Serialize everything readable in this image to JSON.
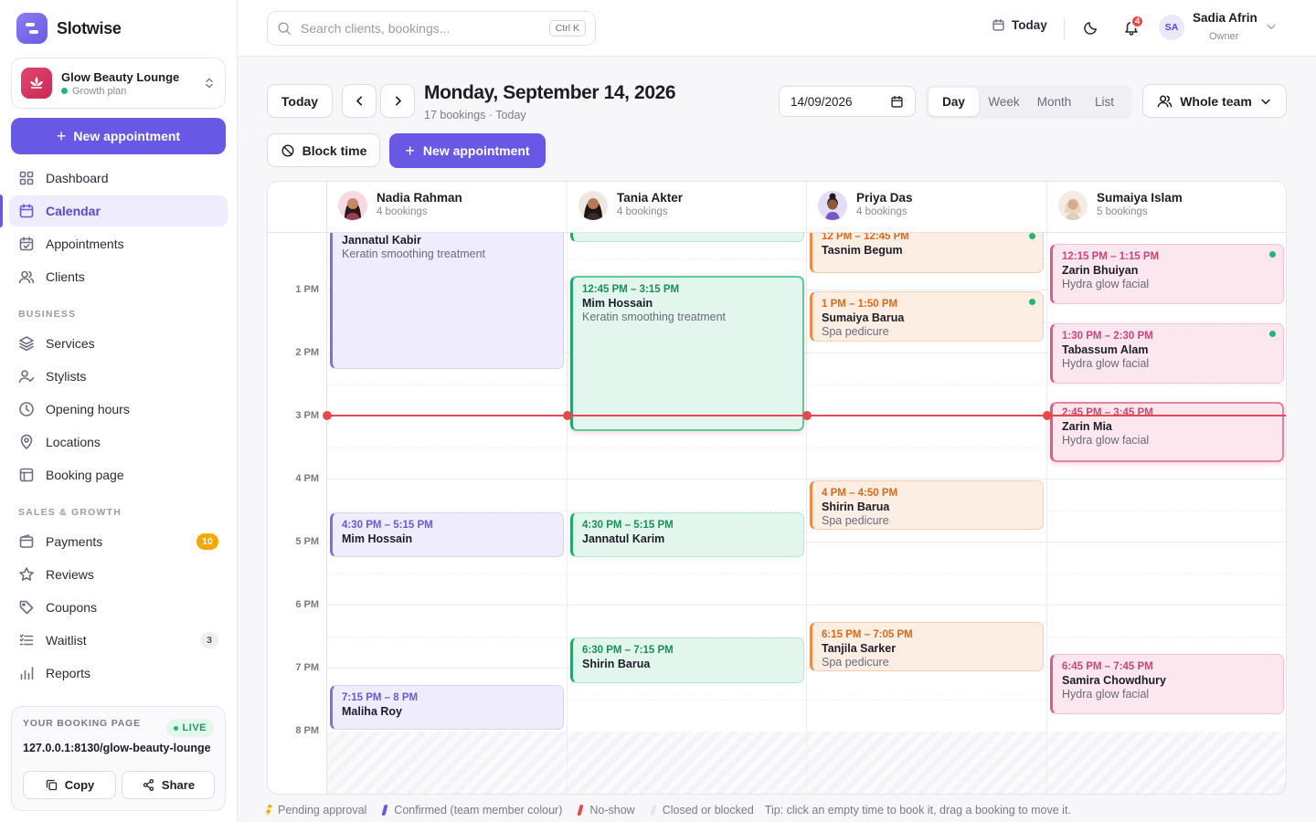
{
  "app": {
    "name": "Slotwise"
  },
  "business": {
    "name": "Glow Beauty Lounge",
    "plan": "Growth plan"
  },
  "sidebar": {
    "new_appointment": "New appointment",
    "items": [
      {
        "label": "Dashboard",
        "icon": "grid-icon"
      },
      {
        "label": "Calendar",
        "icon": "calendar-icon",
        "active": true
      },
      {
        "label": "Appointments",
        "icon": "calendar-check-icon"
      },
      {
        "label": "Clients",
        "icon": "users-icon"
      }
    ],
    "section_business": "BUSINESS",
    "business_items": [
      {
        "label": "Services",
        "icon": "layers-icon"
      },
      {
        "label": "Stylists",
        "icon": "user-check-icon"
      },
      {
        "label": "Opening hours",
        "icon": "clock-icon"
      },
      {
        "label": "Locations",
        "icon": "map-pin-icon"
      },
      {
        "label": "Booking page",
        "icon": "layout-icon"
      }
    ],
    "section_sales": "SALES & GROWTH",
    "sales_items": [
      {
        "label": "Payments",
        "icon": "wallet-icon",
        "badge": "10"
      },
      {
        "label": "Reviews",
        "icon": "star-icon"
      },
      {
        "label": "Coupons",
        "icon": "tag-icon"
      },
      {
        "label": "Waitlist",
        "icon": "list-icon",
        "badge": "3"
      },
      {
        "label": "Reports",
        "icon": "bar-chart-icon"
      }
    ],
    "booking_page": {
      "title": "YOUR BOOKING PAGE",
      "status": "LIVE",
      "url": "127.0.0.1:8130/glow-beauty-lounge",
      "copy": "Copy",
      "share": "Share"
    }
  },
  "topbar": {
    "search_placeholder": "Search clients, bookings...",
    "shortcut": "Ctrl K",
    "today": "Today",
    "notifications": "4",
    "user": {
      "initials": "SA",
      "name": "Sadia Afrin",
      "role": "Owner"
    }
  },
  "toolbar": {
    "today": "Today",
    "title": "Monday, September 14, 2026",
    "subtitle": "17 bookings · Today",
    "date_value": "14/09/2026",
    "views": [
      "Day",
      "Week",
      "Month",
      "List"
    ],
    "active_view": "Day",
    "team_filter": "Whole team",
    "block_time": "Block time",
    "new_appointment": "New appointment"
  },
  "calendar": {
    "time_labels": [
      "1 PM",
      "2 PM",
      "3 PM",
      "4 PM",
      "5 PM",
      "6 PM",
      "7 PM",
      "8 PM"
    ],
    "staff": [
      {
        "name": "Nadia Rahman",
        "bookings": "4 bookings"
      },
      {
        "name": "Tania Akter",
        "bookings": "4 bookings"
      },
      {
        "name": "Priya Das",
        "bookings": "4 bookings"
      },
      {
        "name": "Sumaiya Islam",
        "bookings": "5 bookings"
      }
    ],
    "events": [
      {
        "staff": 0,
        "time": "",
        "client": "Jannatul Kabir",
        "service": "Keratin smoothing treatment"
      },
      {
        "staff": 0,
        "time": "4:30 PM – 5:15 PM",
        "client": "Mim Hossain",
        "service": ""
      },
      {
        "staff": 0,
        "time": "7:15 PM – 8 PM",
        "client": "Maliha Roy",
        "service": ""
      },
      {
        "staff": 1,
        "time": "12:45 PM – 3:15 PM",
        "client": "Mim Hossain",
        "service": "Keratin smoothing treatment"
      },
      {
        "staff": 1,
        "time": "4:30 PM – 5:15 PM",
        "client": "Jannatul Karim",
        "service": ""
      },
      {
        "staff": 1,
        "time": "6:30 PM – 7:15 PM",
        "client": "Shirin Barua",
        "service": ""
      },
      {
        "staff": 2,
        "time": "12 PM – 12:45 PM",
        "client": "Tasnim Begum",
        "service": ""
      },
      {
        "staff": 2,
        "time": "1 PM – 1:50 PM",
        "client": "Sumaiya Barua",
        "service": "Spa pedicure"
      },
      {
        "staff": 2,
        "time": "4 PM – 4:50 PM",
        "client": "Shirin Barua",
        "service": "Spa pedicure"
      },
      {
        "staff": 2,
        "time": "6:15 PM – 7:05 PM",
        "client": "Tanjila Sarker",
        "service": "Spa pedicure"
      },
      {
        "staff": 3,
        "time": "12:15 PM – 1:15 PM",
        "client": "Zarin Bhuiyan",
        "service": "Hydra glow facial"
      },
      {
        "staff": 3,
        "time": "1:30 PM – 2:30 PM",
        "client": "Tabassum Alam",
        "service": "Hydra glow facial"
      },
      {
        "staff": 3,
        "time": "2:45 PM – 3:45 PM",
        "client": "Zarin Mia",
        "service": "Hydra glow facial"
      },
      {
        "staff": 3,
        "time": "6:45 PM – 7:45 PM",
        "client": "Samira Chowdhury",
        "service": "Hydra glow facial"
      }
    ]
  },
  "legend": {
    "pending": "Pending approval",
    "confirmed": "Confirmed (team member colour)",
    "noshow": "No-show",
    "closed": "Closed or blocked",
    "tip": "Tip: click an empty time to book it, drag a booking to move it."
  },
  "colors": {
    "accent": "#6957e6",
    "now_line": "#e5484d",
    "nadia": "#7f6fe0",
    "tania": "#22a86a",
    "priya": "#ee8a43",
    "sumaiya": "#de5b85"
  }
}
